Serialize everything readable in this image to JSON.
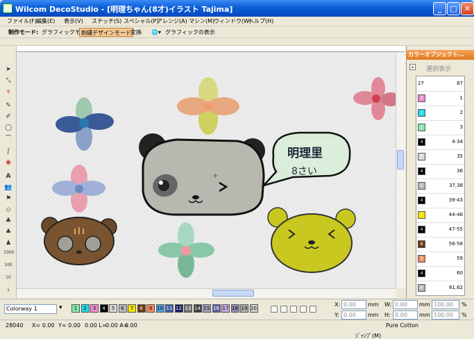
{
  "window": {
    "title": "Wilcom DecoStudio - [明理ちゃん(8才)イラスト   Tajima]",
    "min": "_",
    "max": "□",
    "close": "✕"
  },
  "menu": [
    "ファイル(F)",
    "編集(E)",
    "表示(V)",
    "ステッチ(S)",
    "スペシャル(P)",
    "アレンジ(A)",
    "マシン(M)",
    "ウィンドウ(W)",
    "ヘルプ(H)"
  ],
  "toolbar": {
    "mode_label": "制作モード:",
    "graphic_mode": "グラフィックモード",
    "embroidery_mode": "刺繍デザインモード",
    "convert": "変換",
    "graphic_display": "グラフィックの表示",
    "zoom": "50",
    "zoom_unit": "%"
  },
  "right_panel": {
    "title": "カラーオブジェクト...",
    "select_display": "選択表示",
    "rows": [
      {
        "num": "",
        "range": "27",
        "range2": "87"
      },
      {
        "num": "3",
        "range": "1",
        "color": "#f08bd0"
      },
      {
        "num": "2",
        "range": "2",
        "color": "#22d8e8"
      },
      {
        "num": "1",
        "range": "3",
        "color": "#88e8a8"
      },
      {
        "num": "4",
        "range": "4-34",
        "color": "#000000"
      },
      {
        "num": "5",
        "range": "35",
        "color": "#d8d8d8"
      },
      {
        "num": "4",
        "range": "36",
        "color": "#000000"
      },
      {
        "num": "6",
        "range": "37,38",
        "color": "#b8b8b8"
      },
      {
        "num": "4",
        "range": "39-43",
        "color": "#000000"
      },
      {
        "num": "7",
        "range": "44-46",
        "color": "#f6e200"
      },
      {
        "num": "4",
        "range": "47-55",
        "color": "#000000"
      },
      {
        "num": "8",
        "range": "56-58",
        "color": "#6a3a10"
      },
      {
        "num": "9",
        "range": "59",
        "color": "#f08860"
      },
      {
        "num": "4",
        "range": "60",
        "color": "#000000"
      },
      {
        "num": "6",
        "range": "61,62",
        "color": "#b8b8b8"
      }
    ]
  },
  "colorway": {
    "name": "Colorway 1",
    "swatches": [
      {
        "n": "1",
        "c": "#88e8a8"
      },
      {
        "n": "2",
        "c": "#22d8e8"
      },
      {
        "n": "3",
        "c": "#f08bd0"
      },
      {
        "n": "4",
        "c": "#000000"
      },
      {
        "n": "5",
        "c": "#d8d8d8"
      },
      {
        "n": "6",
        "c": "#b8b8b8"
      },
      {
        "n": "7",
        "c": "#f6e200"
      },
      {
        "n": "8",
        "c": "#6a3a10"
      },
      {
        "n": "9",
        "c": "#f08860"
      },
      {
        "n": "10",
        "c": "#4aa0d8"
      },
      {
        "n": "11",
        "c": "#3a5aa8"
      },
      {
        "n": "12",
        "c": "#1a1a60"
      },
      {
        "n": "13",
        "c": "#707070"
      },
      {
        "n": "14",
        "c": "#404040"
      },
      {
        "n": "15",
        "c": "#a0a0c0"
      },
      {
        "n": "16",
        "c": "#6060a0"
      },
      {
        "n": "17",
        "c": "#c8a8e0"
      },
      {
        "n": "18",
        "c": "#9090b0"
      },
      {
        "n": "19",
        "c": "#b0b0b0"
      },
      {
        "n": "20",
        "c": "#d0d0d0"
      }
    ]
  },
  "coords": {
    "x_label": "X:",
    "x_val": "0.00",
    "y_label": "Y:",
    "y_val": "0.00",
    "w_label": "W:",
    "w_val": "0.00",
    "h_label": "H:",
    "h_val": "0.00",
    "unit_mm": "mm",
    "pct1": "100.00",
    "pct2": "100.00",
    "pct_unit": "%"
  },
  "status": {
    "stitches": "28040",
    "x": "X=   0.00",
    "y": "Y=   0.00",
    "l": "0.00 L=",
    "a": "0.00 A=",
    "a_val": "0.00",
    "fabric": "Pure Cotton",
    "jump": "ｼﾞｬﾝﾌﾟ(M)"
  },
  "canvas": {
    "speech1": "明理里",
    "speech2": "8さい"
  }
}
